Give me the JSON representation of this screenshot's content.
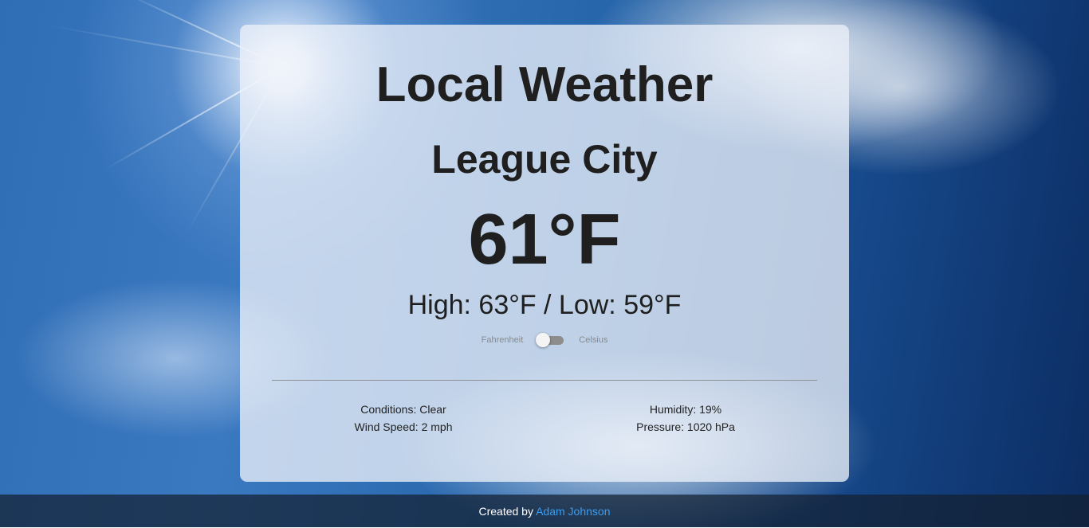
{
  "app": {
    "title": "Local Weather",
    "city": "League City",
    "temperature": "61°F",
    "high_low": "High: 63°F / Low: 59°F"
  },
  "units_toggle": {
    "left_label": "Fahrenheit",
    "right_label": "Celsius",
    "selected": "Fahrenheit"
  },
  "details": {
    "conditions": "Conditions: Clear",
    "wind_speed": "Wind Speed: 2 mph",
    "humidity": "Humidity: 19%",
    "pressure": "Pressure: 1020 hPa"
  },
  "footer": {
    "prefix": "Created by ",
    "author_link": "Adam Johnson"
  },
  "colors": {
    "link": "#3b9cf0",
    "card_background": "#ebf0f8",
    "footer_background": "#142030"
  }
}
